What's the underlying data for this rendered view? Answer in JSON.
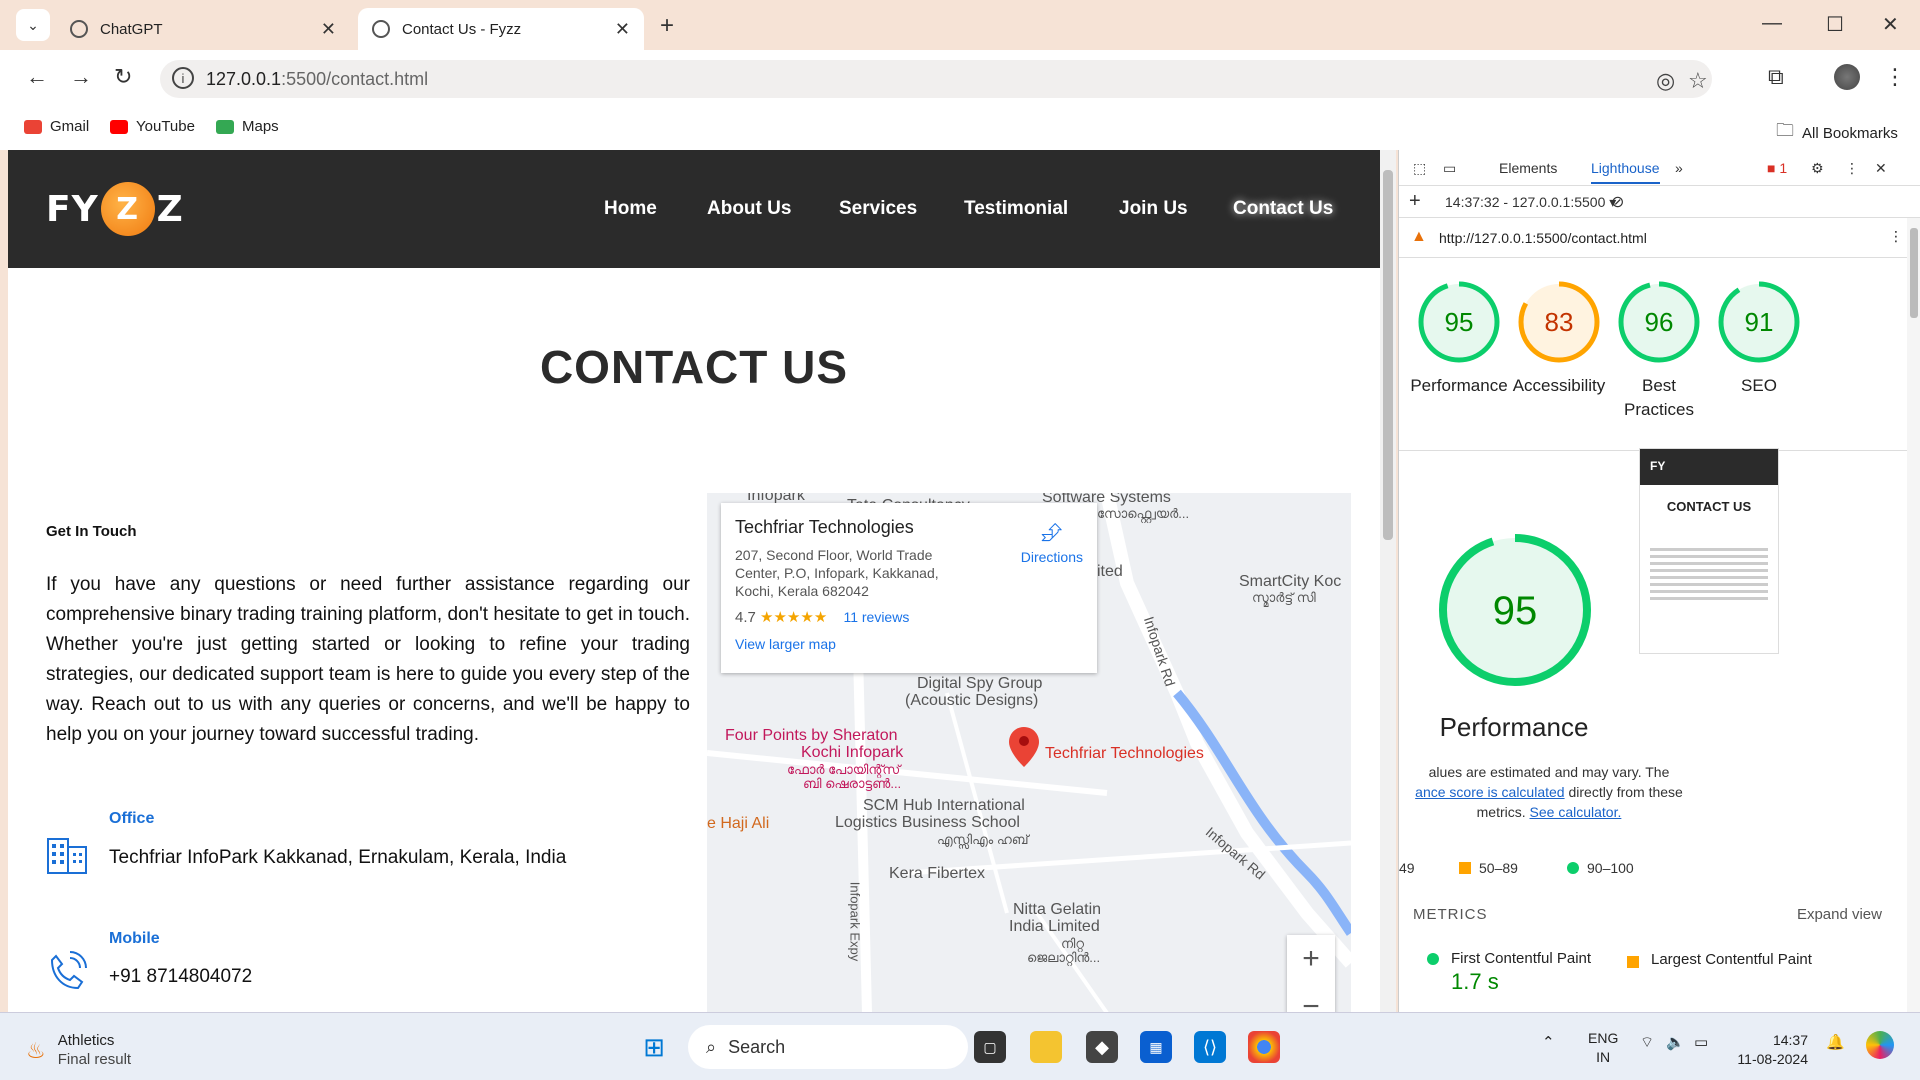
{
  "browser": {
    "tabs": [
      {
        "title": "ChatGPT",
        "active": false
      },
      {
        "title": "Contact Us - Fyzz",
        "active": true
      }
    ],
    "url_host": "127.0.0.1",
    "url_path": ":5500/contact.html",
    "bookmarks": [
      {
        "label": "Gmail",
        "color": "#ea4335"
      },
      {
        "label": "YouTube",
        "color": "#ff0000"
      },
      {
        "label": "Maps",
        "color": "#34a853"
      }
    ],
    "all_bookmarks": "All Bookmarks"
  },
  "site": {
    "logo_left": "FY",
    "logo_badge": "Z",
    "logo_right": "Z",
    "nav": [
      "Home",
      "About Us",
      "Services",
      "Testimonial",
      "Join Us",
      "Contact Us"
    ],
    "active_nav": "Contact Us",
    "title": "CONTACT US",
    "get_in_touch_label": "Get In Touch",
    "get_in_touch_body": "If you have any questions or need further assistance regarding our comprehensive binary trading training platform, don't hesitate to get in touch. Whether you're just getting started or looking to refine your trading strategies, our dedicated support team is here to guide you every step of the way. Reach out to us with any queries or concerns, and we'll be happy to help you on your journey toward successful trading.",
    "office_label": "Office",
    "office_value": "Techfriar InfoPark Kakkanad, Ernakulam, Kerala, India",
    "mobile_label": "Mobile",
    "mobile_value": "+91 8714804072",
    "accent_color": "#1a6fd6"
  },
  "map": {
    "card_title": "Techfriar Technologies",
    "card_address": "207, Second Floor, World Trade Center, P.O, Infopark, Kakkanad, Kochi, Kerala 682042",
    "rating": "4.7",
    "stars": "★★★★★",
    "reviews": "11 reviews",
    "view_larger": "View larger map",
    "directions": "Directions",
    "labels": {
      "infopark_top": "Infopark",
      "tata": "Tata Consultancy",
      "software": "Software Systems",
      "software_ml": "സോഫ്റ്റ്വെയർ...",
      "ited": "ited",
      "smartcity": "SmartCity Koc",
      "smartcity_ml": "സ്മാർട്ട് സി",
      "digital_spy": "Digital Spy Group",
      "acoustic": "(Acoustic Designs)",
      "four_points": "Four Points by Sheraton",
      "kochi_infopark": "Kochi Infopark",
      "four_points_ml1": "ഫോർ പോയിന്റ്സ്",
      "four_points_ml2": "ബി ഷെരാട്ടൺ...",
      "techfriar": "Techfriar Technologies",
      "scm1": "SCM Hub International",
      "scm2": "Logistics Business School",
      "scm_ml": "എസ്സിഎം ഹബ്",
      "haji": "e Haji Ali",
      "kera": "Kera Fibertex",
      "nitta1": "Nitta Gelatin",
      "nitta2": "India Limited",
      "nitta_ml1": "നിറ്റ",
      "nitta_ml2": "ജെലാറ്റിൻ...",
      "infopark_rd": "Infopark Rd",
      "infopark_rd2": "Infopark Rd",
      "infopark_expy": "Infopark Expy"
    }
  },
  "devtools": {
    "tabs": [
      "Elements",
      "Lighthouse"
    ],
    "active_tab": "Lighthouse",
    "issues_count": "1",
    "report_label": "14:37:32 - 127.0.0.1:5500",
    "audited_url": "http://127.0.0.1:5500/contact.html",
    "scores": [
      {
        "label": "Performance",
        "value": 95,
        "color": "#0cce6b"
      },
      {
        "label": "Accessibility",
        "value": 83,
        "color": "#ffa400"
      },
      {
        "label": "Best Practices",
        "value": 96,
        "color": "#0cce6b"
      },
      {
        "label": "SEO",
        "value": 91,
        "color": "#0cce6b"
      }
    ],
    "big_score": 95,
    "big_label": "Performance",
    "note_prefix": "alues are estimated and may vary. The",
    "note_link1": "ance score is calculated",
    "note_mid": " directly from these metrics.",
    "note_link2": "See calculator.",
    "legend": [
      "49",
      "50–89",
      "90–100"
    ],
    "metrics_head": "METRICS",
    "expand_view": "Expand view",
    "metric_fcp": "First Contentful Paint",
    "metric_fcp_value": "1.7 s",
    "metric_lcp": "Largest Contentful Paint",
    "thumb_logo": "FY",
    "thumb_title": "CONTACT US"
  },
  "taskbar": {
    "weather_title": "Athletics",
    "weather_sub": "Final result",
    "search": "Search",
    "lang1": "ENG",
    "lang2": "IN",
    "time": "14:37",
    "date": "11-08-2024"
  }
}
